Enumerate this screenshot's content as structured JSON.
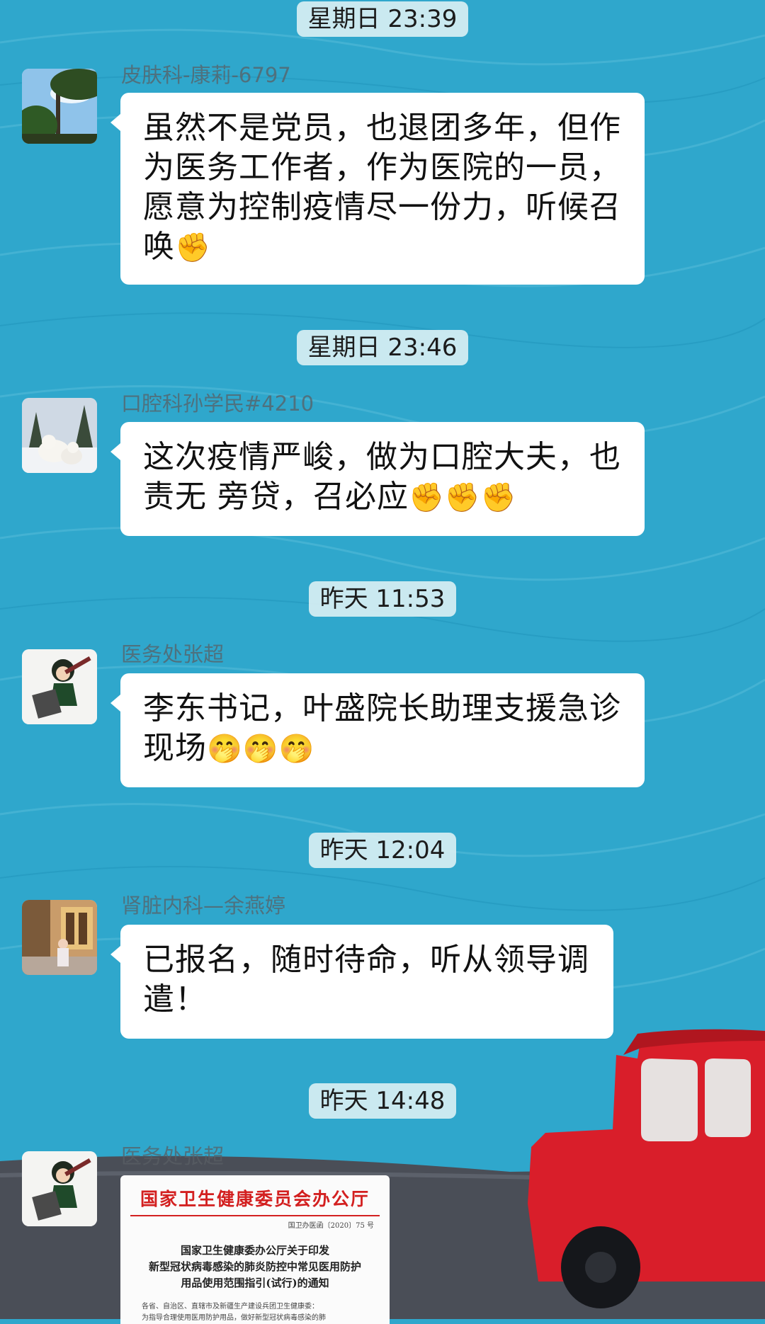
{
  "colors": {
    "background": "#2fa7cc",
    "bubble": "#ffffff",
    "timestamp_bg": "#d6eef2",
    "doc_header_red": "#d32020",
    "car_red": "#d91e2a"
  },
  "messages": [
    {
      "time": "星期日 23:39",
      "sender": "皮肤科-康莉-6797",
      "avatar": "tree-sky-avatar",
      "lines": [
        "虽然不是党员，也退团多年，但作",
        "为医务工作者，作为医院的一员，",
        "愿意为控制疫情尽一份力，听候召",
        "唤"
      ],
      "emoji": "✊"
    },
    {
      "time": "星期日 23:46",
      "sender": "口腔科孙学民#4210",
      "avatar": "polar-bears-avatar",
      "lines": [
        "这次疫情严峻，做为口腔大夫，也",
        "责无 旁贷，召必应"
      ],
      "emoji": "✊✊✊"
    },
    {
      "time": "昨天 11:53",
      "sender": "医务处张超",
      "avatar": "cartoon-hammer-avatar",
      "lines": [
        "李东书记，叶盛院长助理支援急诊",
        "现场"
      ],
      "emoji": "🤭🤭🤭"
    },
    {
      "time": "昨天 12:04",
      "sender": "肾脏内科—余燕婷",
      "avatar": "street-photo-avatar",
      "lines": [
        "已报名，随时待命，听从领导调",
        "遣！"
      ],
      "emoji": ""
    },
    {
      "time": "昨天 14:48",
      "sender": "医务处张超",
      "avatar": "cartoon-hammer-avatar",
      "document": {
        "header": "国家卫生健康委员会办公厅",
        "number": "国卫办医函〔2020〕75 号",
        "title": [
          "国家卫生健康委办公厅关于印发",
          "新型冠状病毒感染的肺炎防控中常见医用防护",
          "用品使用范围指引(试行)的通知"
        ],
        "body": [
          "各省、自治区、直辖市及新疆生产建设兵团卫生健康委：",
          "为指导合理使用医用防护用品，做好新型冠状病毒感染的肺"
        ]
      }
    }
  ]
}
